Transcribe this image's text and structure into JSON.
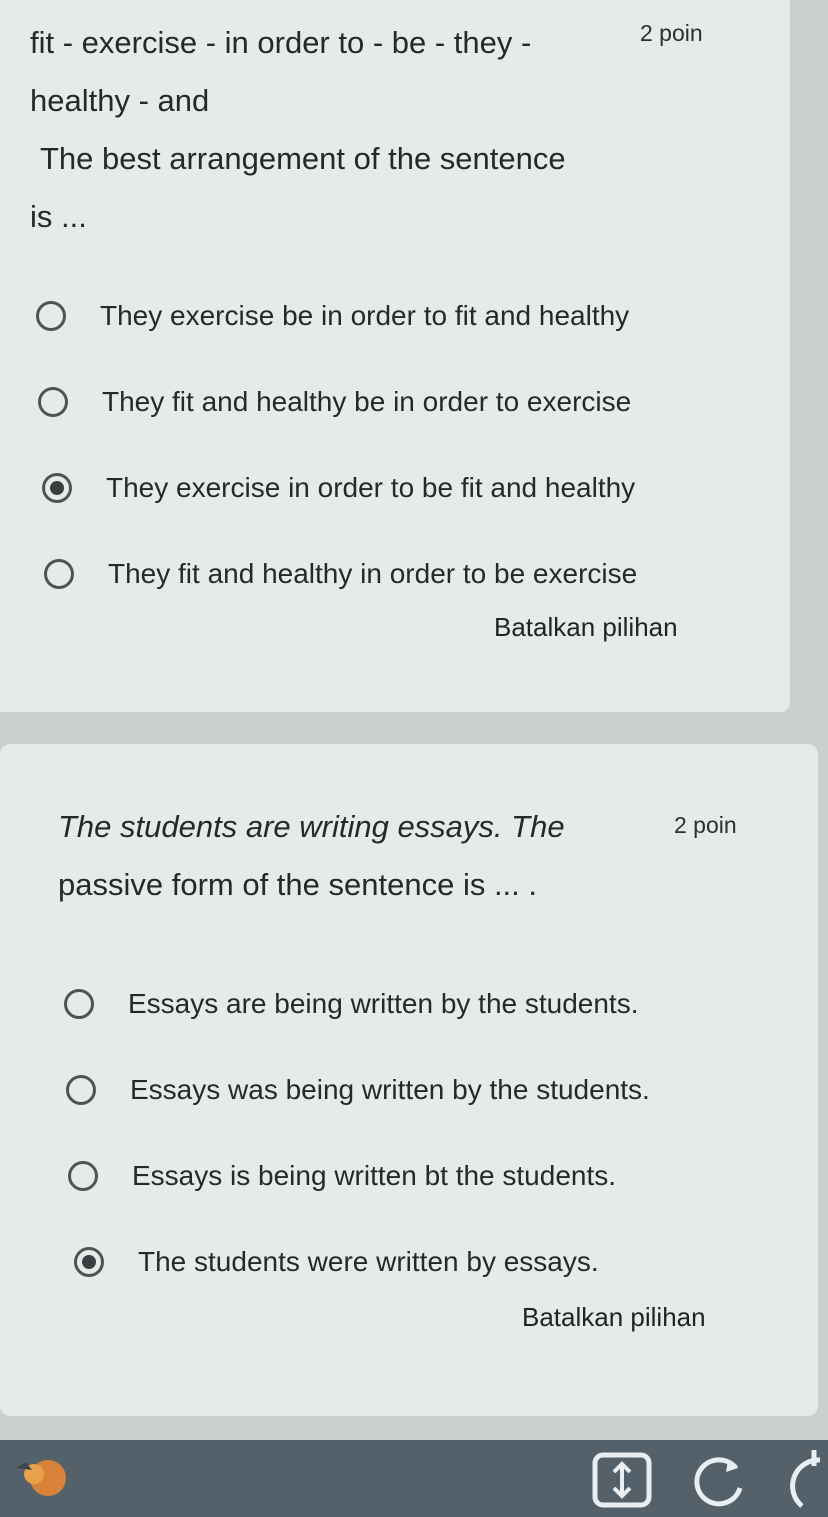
{
  "question1": {
    "text_line1": "fit - exercise - in order to - be - they -",
    "text_line2": "healthy - and",
    "text_line3": "The best arrangement of the sentence",
    "text_line4": "is ...",
    "points": "2 poin",
    "options": [
      {
        "label": "They exercise be in order to fit and healthy",
        "selected": false
      },
      {
        "label": "They fit and healthy be in order to exercise",
        "selected": false
      },
      {
        "label": "They exercise in order to be fit and healthy",
        "selected": true
      },
      {
        "label": "They fit and healthy in order to be exercise",
        "selected": false
      }
    ],
    "clear_label": "Batalkan pilihan"
  },
  "question2": {
    "text_line1": "The students are writing essays. The",
    "text_line2": "passive form of the sentence is ... .",
    "points": "2 poin",
    "options": [
      {
        "label": "Essays are being written by the students.",
        "selected": false
      },
      {
        "label": "Essays was being written by the students.",
        "selected": false
      },
      {
        "label": "Essays is being written bt the students.",
        "selected": false
      },
      {
        "label": "The students were written by essays.",
        "selected": true
      }
    ],
    "clear_label": "Batalkan pilihan"
  },
  "bottom_bar": {
    "icons": [
      "app-icon",
      "scroll-icon",
      "rotate-icon",
      "refresh-icon"
    ]
  },
  "colors": {
    "card_bg": "#e6ebe8",
    "page_bg": "#c9cfcc",
    "text": "#26292a",
    "bottom_bar": "#55616a"
  }
}
